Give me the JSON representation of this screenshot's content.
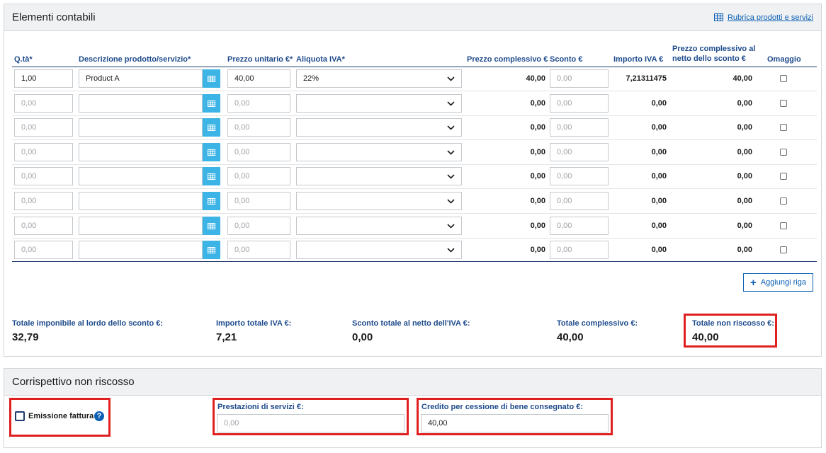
{
  "section1": {
    "title": "Elementi contabili",
    "link_label": "Rubrica prodotti e servizi"
  },
  "columns": {
    "qty": "Q.tà*",
    "desc": "Descrizione prodotto/servizio*",
    "price": "Prezzo unitario €*",
    "vat_rate": "Aliquota IVA*",
    "total": "Prezzo complessivo €",
    "discount": "Sconto €",
    "vat_amount": "Importo IVA €",
    "net_total_line1": "Prezzo complessivo al",
    "net_total_line2": "netto dello sconto €",
    "gift": "Omaggio"
  },
  "rows": [
    {
      "qty": "1,00",
      "desc": "Product A",
      "price": "40,00",
      "vat": "22%",
      "total": "40,00",
      "discount": "0,00",
      "vat_amount": "7,21311475",
      "net_total": "40,00",
      "filled": true
    },
    {
      "qty": "0,00",
      "desc": "",
      "price": "0,00",
      "vat": "",
      "total": "0,00",
      "discount": "0,00",
      "vat_amount": "0,00",
      "net_total": "0,00",
      "filled": false
    },
    {
      "qty": "0,00",
      "desc": "",
      "price": "0,00",
      "vat": "",
      "total": "0,00",
      "discount": "0,00",
      "vat_amount": "0,00",
      "net_total": "0,00",
      "filled": false
    },
    {
      "qty": "0,00",
      "desc": "",
      "price": "0,00",
      "vat": "",
      "total": "0,00",
      "discount": "0,00",
      "vat_amount": "0,00",
      "net_total": "0,00",
      "filled": false
    },
    {
      "qty": "0,00",
      "desc": "",
      "price": "0,00",
      "vat": "",
      "total": "0,00",
      "discount": "0,00",
      "vat_amount": "0,00",
      "net_total": "0,00",
      "filled": false
    },
    {
      "qty": "0,00",
      "desc": "",
      "price": "0,00",
      "vat": "",
      "total": "0,00",
      "discount": "0,00",
      "vat_amount": "0,00",
      "net_total": "0,00",
      "filled": false
    },
    {
      "qty": "0,00",
      "desc": "",
      "price": "0,00",
      "vat": "",
      "total": "0,00",
      "discount": "0,00",
      "vat_amount": "0,00",
      "net_total": "0,00",
      "filled": false
    },
    {
      "qty": "0,00",
      "desc": "",
      "price": "0,00",
      "vat": "",
      "total": "0,00",
      "discount": "0,00",
      "vat_amount": "0,00",
      "net_total": "0,00",
      "filled": false
    }
  ],
  "add_row_label": "Aggiungi riga",
  "totals": {
    "taxable_label": "Totale imponibile al lordo dello sconto €:",
    "taxable_value": "32,79",
    "vat_label": "Importo totale IVA €:",
    "vat_value": "7,21",
    "discount_label": "Sconto totale al netto dell'IVA €:",
    "discount_value": "0,00",
    "grand_label": "Totale complessivo €:",
    "grand_value": "40,00",
    "uncollected_label": "Totale non riscosso €:",
    "uncollected_value": "40,00"
  },
  "section2": {
    "title": "Corrispettivo non riscosso",
    "invoice_label": "Emissione fattura",
    "services_label": "Prestazioni di servizi €:",
    "services_placeholder": "0,00",
    "credit_label": "Credito per cessione di bene consegnato €:",
    "credit_value": "40,00"
  },
  "colors": {
    "accent_blue": "#1e4b8c",
    "link_blue": "#0a5fb4",
    "grid_button": "#3cb4e5",
    "highlight_red": "#e02020",
    "header_bg": "#f0f1f3"
  }
}
